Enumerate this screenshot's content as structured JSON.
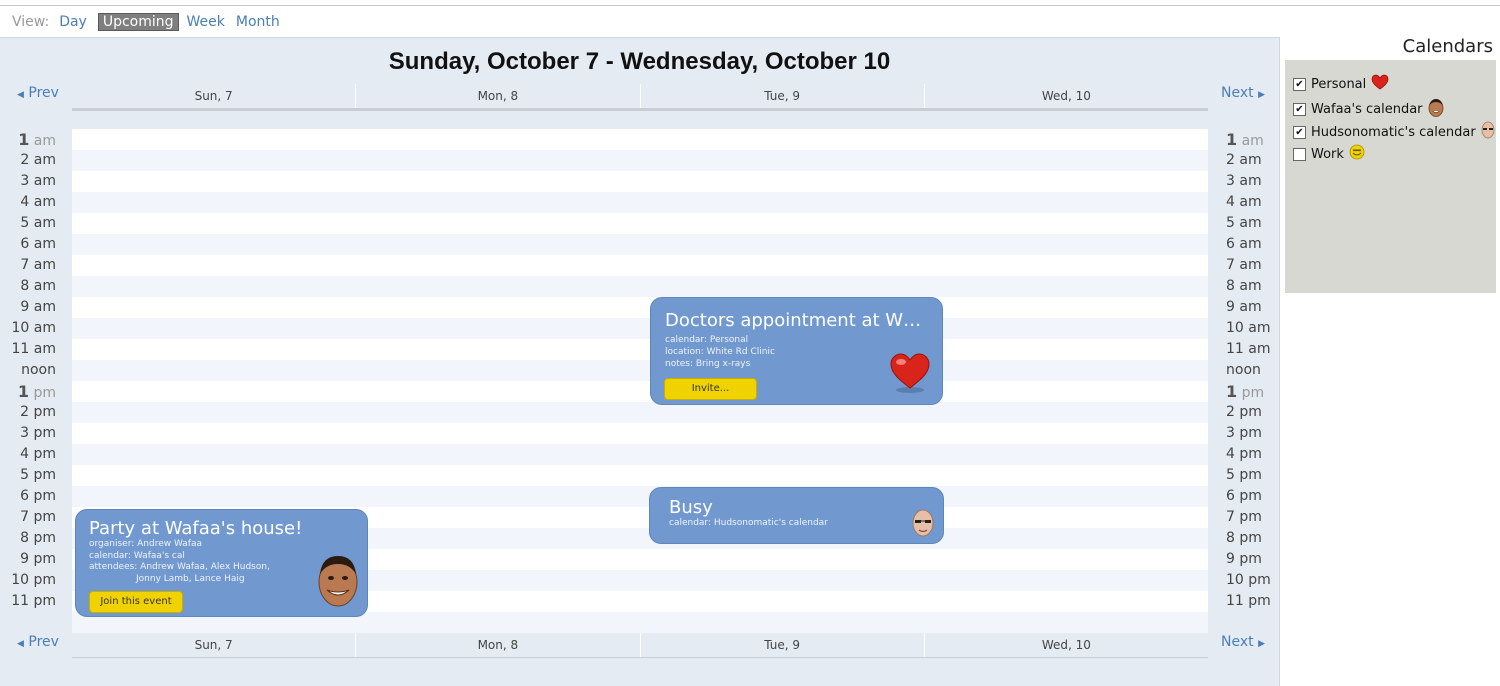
{
  "view_bar": {
    "label": "View:",
    "options": [
      "Day",
      "Upcoming",
      "Week",
      "Month"
    ],
    "active": "Upcoming"
  },
  "title": "Sunday, October 7 - Wednesday, October 10",
  "nav": {
    "prev": "Prev",
    "next": "Next"
  },
  "days": [
    "Sun, 7",
    "Mon, 8",
    "Tue, 9",
    "Wed, 10"
  ],
  "hours": [
    {
      "num": "1",
      "suffix": "am",
      "bold": true
    },
    {
      "num": "2",
      "suffix": "am"
    },
    {
      "num": "3",
      "suffix": "am"
    },
    {
      "num": "4",
      "suffix": "am"
    },
    {
      "num": "5",
      "suffix": "am"
    },
    {
      "num": "6",
      "suffix": "am"
    },
    {
      "num": "7",
      "suffix": "am"
    },
    {
      "num": "8",
      "suffix": "am"
    },
    {
      "num": "9",
      "suffix": "am"
    },
    {
      "num": "10",
      "suffix": "am"
    },
    {
      "num": "11",
      "suffix": "am"
    },
    {
      "num": "noon",
      "suffix": ""
    },
    {
      "num": "1",
      "suffix": "pm",
      "bold": true
    },
    {
      "num": "2",
      "suffix": "pm"
    },
    {
      "num": "3",
      "suffix": "pm"
    },
    {
      "num": "4",
      "suffix": "pm"
    },
    {
      "num": "5",
      "suffix": "pm"
    },
    {
      "num": "6",
      "suffix": "pm"
    },
    {
      "num": "7",
      "suffix": "pm"
    },
    {
      "num": "8",
      "suffix": "pm"
    },
    {
      "num": "9",
      "suffix": "pm"
    },
    {
      "num": "10",
      "suffix": "pm"
    },
    {
      "num": "11",
      "suffix": "pm"
    }
  ],
  "events": {
    "doctor": {
      "title": "Doctors appointment at Wh...",
      "calendar": "calendar: Personal",
      "location": "location: White Rd Clinic",
      "notes": "notes: Bring x-rays",
      "button": "Invite...",
      "icon": "heart-icon"
    },
    "busy": {
      "title": "Busy",
      "calendar": "calendar: Hudsonomatic's calendar",
      "icon": "bald-man-avatar-icon"
    },
    "party": {
      "title": "Party at Wafaa's house!",
      "organiser": "organiser: Andrew Wafaa",
      "calendar": "calendar: Wafaa's cal",
      "attendees_1": "attendees: Andrew Wafaa, Alex Hudson,",
      "attendees_2": "Jonny Lamb, Lance Haig",
      "button": "Join this event",
      "icon": "smiling-man-avatar-icon"
    }
  },
  "calendars": {
    "title": "Calendars",
    "items": [
      {
        "name": "Personal",
        "checked": true,
        "icon": "heart-icon"
      },
      {
        "name": "Wafaa's calendar",
        "checked": true,
        "icon": "man-avatar-icon"
      },
      {
        "name": "Hudsonomatic's calendar",
        "checked": true,
        "icon": "bald-man-avatar-icon"
      },
      {
        "name": "Work",
        "checked": false,
        "icon": "yellow-smiley-icon"
      }
    ]
  },
  "colors": {
    "accent_link": "#4a7fb6",
    "event_bg": "#7199cf",
    "button_yellow": "#f0d200",
    "main_bg": "#e5ebf3",
    "sidebar_bg": "#d8d8d3"
  }
}
